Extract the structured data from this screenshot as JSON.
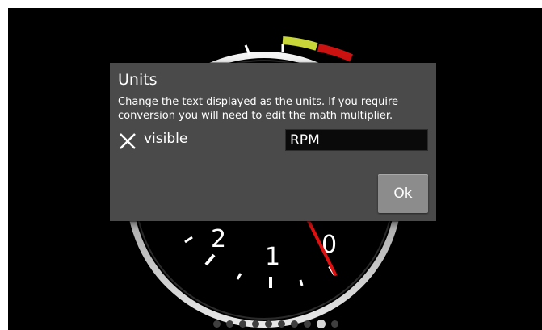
{
  "gauge": {
    "numbers": [
      "2",
      "1",
      "0"
    ],
    "needle_color": "#e01010",
    "zone_colors": {
      "caution": "#c8d63a",
      "redline": "#cc1111"
    }
  },
  "dialog": {
    "title": "Units",
    "message": "Change the text displayed as the units. If you require conversion you will need to edit the math multiplier.",
    "checkbox_label": "visible",
    "checkbox_checked": true,
    "checkbox_icon": "x-mark-icon",
    "units_value": "RPM",
    "ok_label": "Ok"
  },
  "pager": {
    "page_count": 10,
    "active_page": 9
  }
}
